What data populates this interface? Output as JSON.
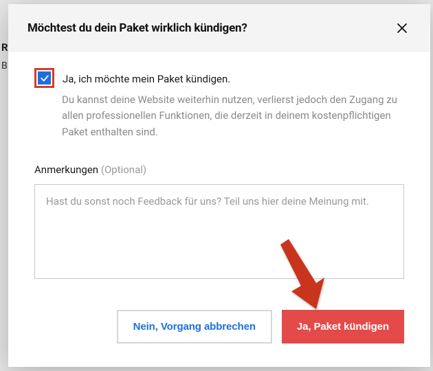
{
  "backdrop": {
    "label1": "R",
    "label2": "B"
  },
  "modal": {
    "title": "Möchtest du dein Paket wirklich kündigen?",
    "checkbox": {
      "checked": true,
      "label": "Ja, ich möchte mein Paket kündigen.",
      "help": "Du kannst deine Website weiterhin nutzen, verlierst jedoch den Zugang zu allen professionellen Funktionen, die derzeit in deinem kostenpflichtigen Paket enthalten sind."
    },
    "comments": {
      "label": "Anmerkungen",
      "optional": "(Optional)",
      "placeholder": "Hast du sonst noch Feedback für uns? Teil uns hier deine Meinung mit."
    },
    "buttons": {
      "cancel": "Nein, Vorgang abbrechen",
      "confirm": "Ja, Paket kündigen"
    }
  },
  "colors": {
    "accent_blue": "#1d6fdc",
    "accent_red": "#e44a4a",
    "highlight_red": "#d63b2a"
  }
}
